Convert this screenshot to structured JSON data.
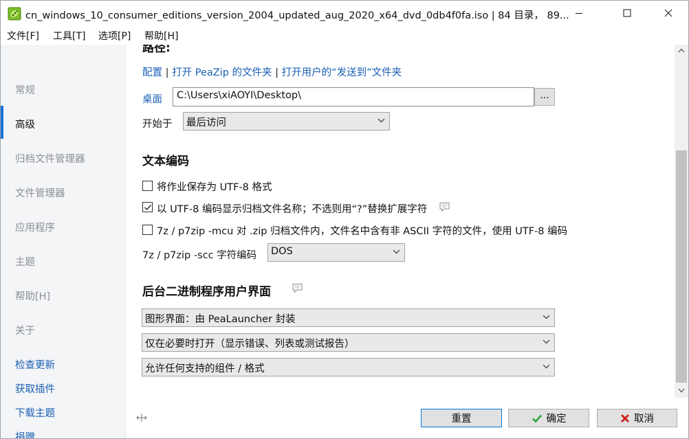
{
  "window": {
    "title": "cn_windows_10_consumer_editions_version_2004_updated_aug_2020_x64_dvd_0db4f0fa.iso | 84 目录， 89..."
  },
  "menu": [
    "文件[F]",
    "工具[T]",
    "选项[P]",
    "帮助[H]"
  ],
  "sidebar": {
    "items": [
      {
        "label": "常规"
      },
      {
        "label": "高级"
      },
      {
        "label": "归档文件管理器"
      },
      {
        "label": "文件管理器"
      },
      {
        "label": "应用程序"
      },
      {
        "label": "主题"
      },
      {
        "label": "帮助[H]"
      },
      {
        "label": "关于"
      }
    ],
    "active_index": 1,
    "links": [
      {
        "label": "检查更新"
      },
      {
        "label": "获取插件"
      },
      {
        "label": "下载主题"
      },
      {
        "label": "捐赠"
      }
    ]
  },
  "paths": {
    "heading": "路径:",
    "link_config": "配置",
    "link_open_peazip": "打开 PeaZip 的文件夹",
    "link_open_sendto": "打开用户的“发送到”文件夹",
    "separator": "|",
    "desktop_label": "桌面",
    "desktop_value": "C:\\Users\\xiAOYI\\Desktop\\",
    "browse_label": "...",
    "start_label": "开始于",
    "start_value": "最后访问"
  },
  "encoding": {
    "heading": "文本编码",
    "opt1_label": "将作业保存为 UTF-8 格式",
    "opt1_checked": false,
    "opt2_label": "以 UTF-8 编码显示归档文件名称；不选则用“?”替换扩展字符",
    "opt2_checked": true,
    "opt3_label": "7z / p7zip -mcu 对 .zip 归档文件内，文件名中含有非 ASCII 字符的文件，使用 UTF-8 编码",
    "opt3_checked": false,
    "scc_label": "7z / p7zip -scc 字符编码",
    "scc_value": "DOS"
  },
  "backend": {
    "heading": "后台二进制程序用户界面",
    "gui_value": "图形界面：由 PeaLauncher 封装",
    "open_value": "仅在必要时打开（显示错误、列表或测试报告）",
    "allow_value": "允许任何支持的组件 / 格式"
  },
  "buttons": {
    "reset": "重置",
    "ok": "确定",
    "cancel": "取消"
  },
  "colors": {
    "accent": "#1a73d9",
    "link": "#1a5fb4",
    "ok_green": "#2aa33a",
    "cancel_red": "#d21f1f"
  }
}
